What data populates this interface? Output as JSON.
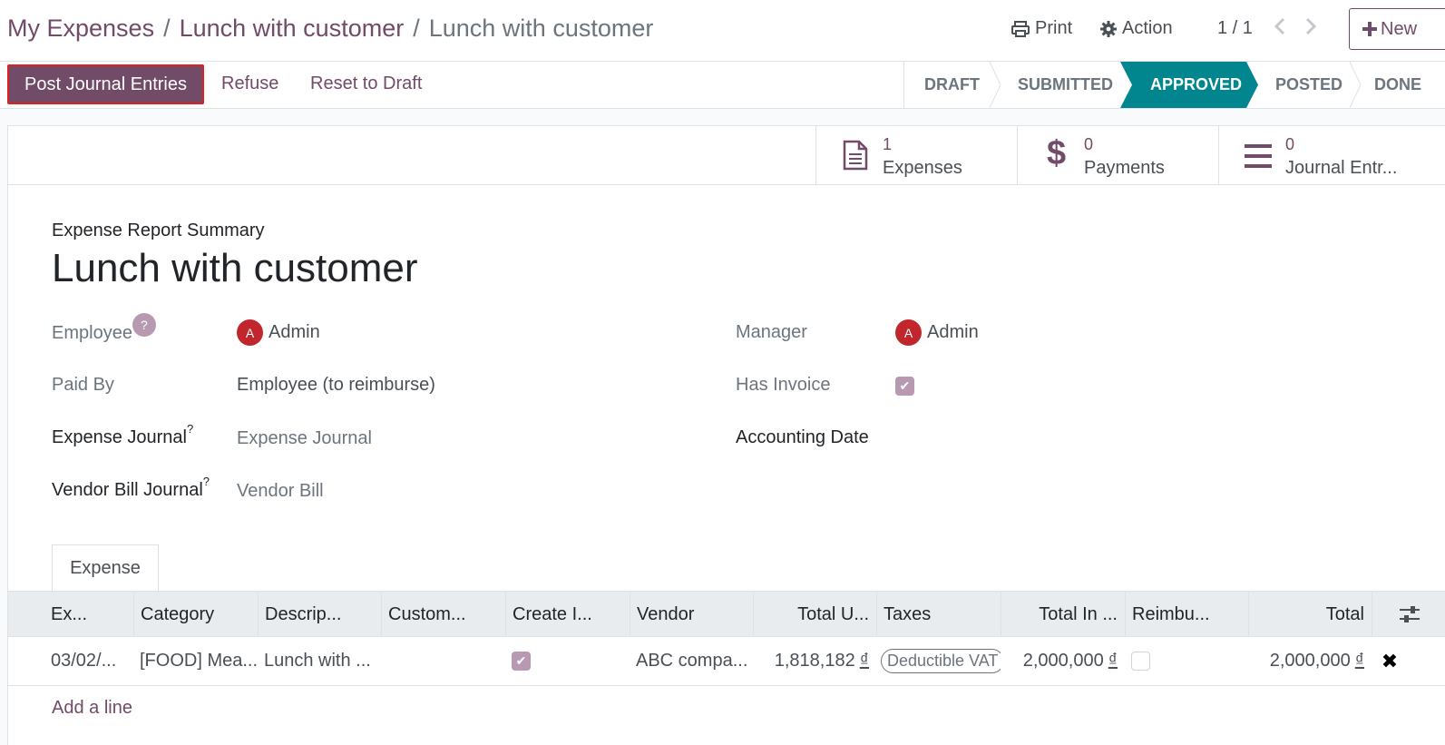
{
  "breadcrumb": {
    "items": [
      "My Expenses",
      "Lunch with customer"
    ],
    "current": "Lunch with customer"
  },
  "toolbar": {
    "print_label": "Print",
    "action_label": "Action",
    "pager": "1 / 1",
    "new_label": "New"
  },
  "status_actions": {
    "post_label": "Post Journal Entries",
    "refuse_label": "Refuse",
    "reset_label": "Reset to Draft"
  },
  "stages": [
    {
      "label": "DRAFT",
      "active": false
    },
    {
      "label": "SUBMITTED",
      "active": false
    },
    {
      "label": "APPROVED",
      "active": true
    },
    {
      "label": "POSTED",
      "active": false
    },
    {
      "label": "DONE",
      "active": false
    }
  ],
  "smart_buttons": [
    {
      "count": "1",
      "label": "Expenses",
      "icon": "file-text-icon"
    },
    {
      "count": "0",
      "label": "Payments",
      "icon": "dollar-icon"
    },
    {
      "count": "0",
      "label": "Journal Entr...",
      "icon": "bars-icon"
    }
  ],
  "form": {
    "subtitle": "Expense Report Summary",
    "title": "Lunch with customer",
    "employee_label": "Employee",
    "employee_help": "?",
    "employee_value": "Admin",
    "employee_avatar": "A",
    "paid_by_label": "Paid By",
    "paid_by_value": "Employee (to reimburse)",
    "expense_journal_label": "Expense Journal",
    "expense_journal_placeholder": "Expense Journal",
    "vendor_bill_journal_label": "Vendor Bill Journal",
    "vendor_bill_journal_placeholder": "Vendor Bill",
    "help_mark": "?",
    "manager_label": "Manager",
    "manager_value": "Admin",
    "manager_avatar": "A",
    "has_invoice_label": "Has Invoice",
    "has_invoice": true,
    "accounting_date_label": "Accounting Date"
  },
  "tab": {
    "label": "Expense"
  },
  "table": {
    "headers": [
      "Ex...",
      "Category",
      "Descrip...",
      "Custom...",
      "Create I...",
      "Vendor",
      "Total U...",
      "Taxes",
      "Total In ...",
      "Reimbu...",
      "Total"
    ],
    "row": {
      "date": "03/02/...",
      "category": "[FOOD] Mea...",
      "description": "Lunch with ...",
      "customer": "",
      "create_invoice": true,
      "vendor": "ABC compa...",
      "total_untaxed": "1,818,182",
      "taxes": "Deductible VAT",
      "total_incl": "2,000,000",
      "reimbursed": false,
      "total": "2,000,000",
      "currency": "₫"
    },
    "add_line_label": "Add a line"
  },
  "colors": {
    "brand": "#714b67",
    "stage_active": "#01858f",
    "avatar": "#c0262c"
  }
}
